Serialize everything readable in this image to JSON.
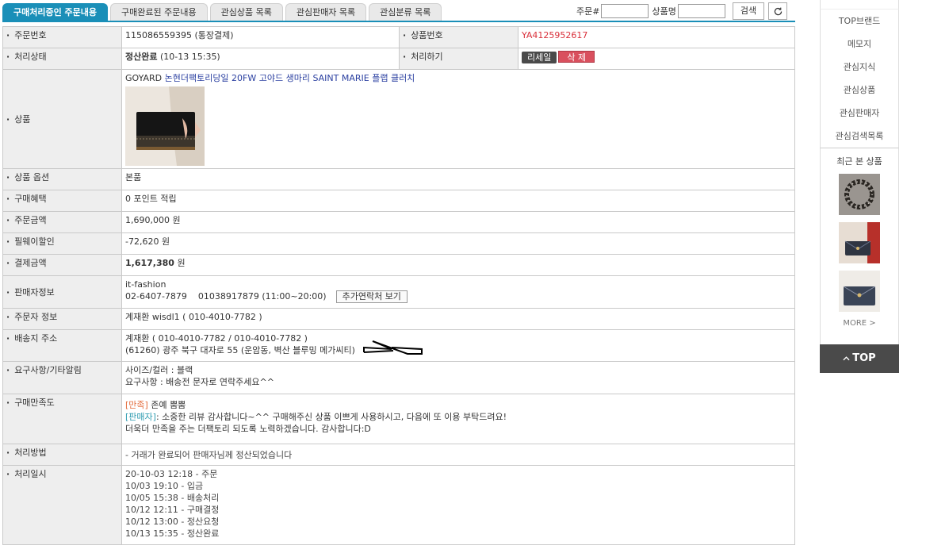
{
  "tabs": [
    {
      "label": "구매처리중인 주문내용",
      "active": true
    },
    {
      "label": "구매완료된 주문내용",
      "active": false
    },
    {
      "label": "관심상품 목록",
      "active": false
    },
    {
      "label": "관심판매자 목록",
      "active": false
    },
    {
      "label": "관심분류 목록",
      "active": false
    }
  ],
  "search": {
    "order_label": "주문#",
    "order_value": "",
    "product_label": "상품명",
    "product_value": "",
    "button": "검색",
    "refresh_icon": "refresh-icon"
  },
  "order": {
    "order_no_label": "주문번호",
    "order_no": "115086559395 (통장결제)",
    "product_no_label": "상품번호",
    "product_no": "YA4125952617",
    "status_label": "처리상태",
    "status_strong": "정산완료",
    "status_time": "(10-13 15:35)",
    "action_label": "처리하기",
    "resell_button": "리세일",
    "delete_button": "삭 제",
    "product_label": "상품",
    "product_brand": "GOYARD",
    "product_title": "논현더팩토리당일 20FW 고야드 생마리 SAINT MARIE 플랩 클러치",
    "option_label": "상품 옵션",
    "option_value": "본품",
    "benefit_label": "구매혜택",
    "benefit_value": "0 포인트 적립",
    "amount_label": "주문금액",
    "amount_value": "1,690,000 원",
    "discount_label": "필웨이할인",
    "discount_value": "-72,620 원",
    "pay_label": "결제금액",
    "pay_value": "1,617,380",
    "pay_unit": "원",
    "seller_label": "판매자정보",
    "seller_name": "it-fashion",
    "seller_contact": "02-6407-7879    01038917879 (11:00~20:00)",
    "seller_more_button": "추가연락처 보기",
    "buyer_label": "주문자 정보",
    "buyer_value": "계재환 wisdl1 ( 010-4010-7782 )",
    "ship_label": "배송지 주소",
    "ship_line1": "계재환 ( 010-4010-7782 / 010-4010-7782 )",
    "ship_line2": "(61260) 광주 북구 대자로 55 (운암동, 벽산 블루밍 메가씨티)",
    "request_label": "요구사항/기타알림",
    "request_line1": "사이즈/컬러 : 블랙",
    "request_line2": "요구사항 : 배송전 문자로 연락주세요^^",
    "review_label": "구매만족도",
    "review_tag": "[만족]",
    "review_text": "존예 뿜뿜",
    "reply_tag": "[판매자]",
    "reply_text": ": 소중한 리뷰 감사합니다~^^ 구매해주신 상품 이쁘게 사용하시고, 다음에 또 이용 부탁드려요!",
    "reply_text2": "더욱더 만족을 주는 더팩토리 되도록 노력하겠습니다. 감사합니다:D",
    "method_label": "처리방법",
    "method_value": "- 거래가 완료되어 판매자님께 정산되었습니다",
    "history_label": "처리일시",
    "history": [
      "20-10-03 12:18 - 주문",
      "10/03 19:10 - 입금",
      "10/05 15:38 - 배송처리",
      "10/12 12:11 - 구매결정",
      "10/12 13:00 - 정산요청",
      "10/13 15:35 - 정산완료"
    ]
  },
  "sidebar": {
    "items": [
      "TOP브랜드",
      "메모지",
      "관심지식",
      "관심상품",
      "관심판매자",
      "관심검색목록"
    ],
    "recent_title": "최근 본 상품",
    "more": "MORE >",
    "top": "TOP",
    "top_icon": "chevron-up-icon"
  },
  "colors": {
    "accent": "#1a8fb8",
    "label_bg": "#eeeeee",
    "product_no": "#d9303b",
    "delete": "#d9505e"
  }
}
